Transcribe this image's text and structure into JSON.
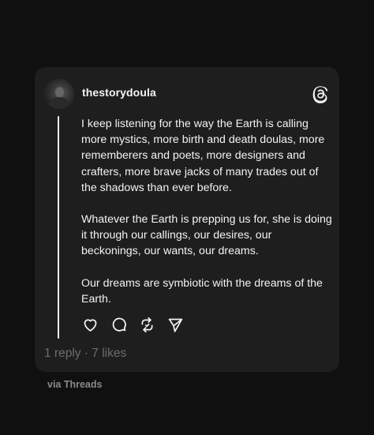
{
  "post": {
    "username": "thestorydoula",
    "paragraphs": [
      "I keep listening for the way the Earth is calling more mystics, more birth and death doulas, more rememberers and poets, more designers and crafters, more brave jacks of many trades out of the shadows than ever before.",
      "Whatever the Earth is prepping us for, she is doing it through our callings, our desires, our beckonings, our wants, our dreams.",
      "Our dreams are symbiotic with the dreams of the Earth."
    ],
    "stats": "1 reply · 7 likes"
  },
  "icons": {
    "brand": "threads-logo-icon",
    "like": "heart-icon",
    "reply": "comment-icon",
    "repost": "repost-icon",
    "share": "send-icon"
  },
  "footer": {
    "via": "via Threads"
  },
  "colors": {
    "page_background": "#101010",
    "card_background": "#1e1e1e",
    "text": "#f3f3f3",
    "muted": "#6d6d6d"
  }
}
